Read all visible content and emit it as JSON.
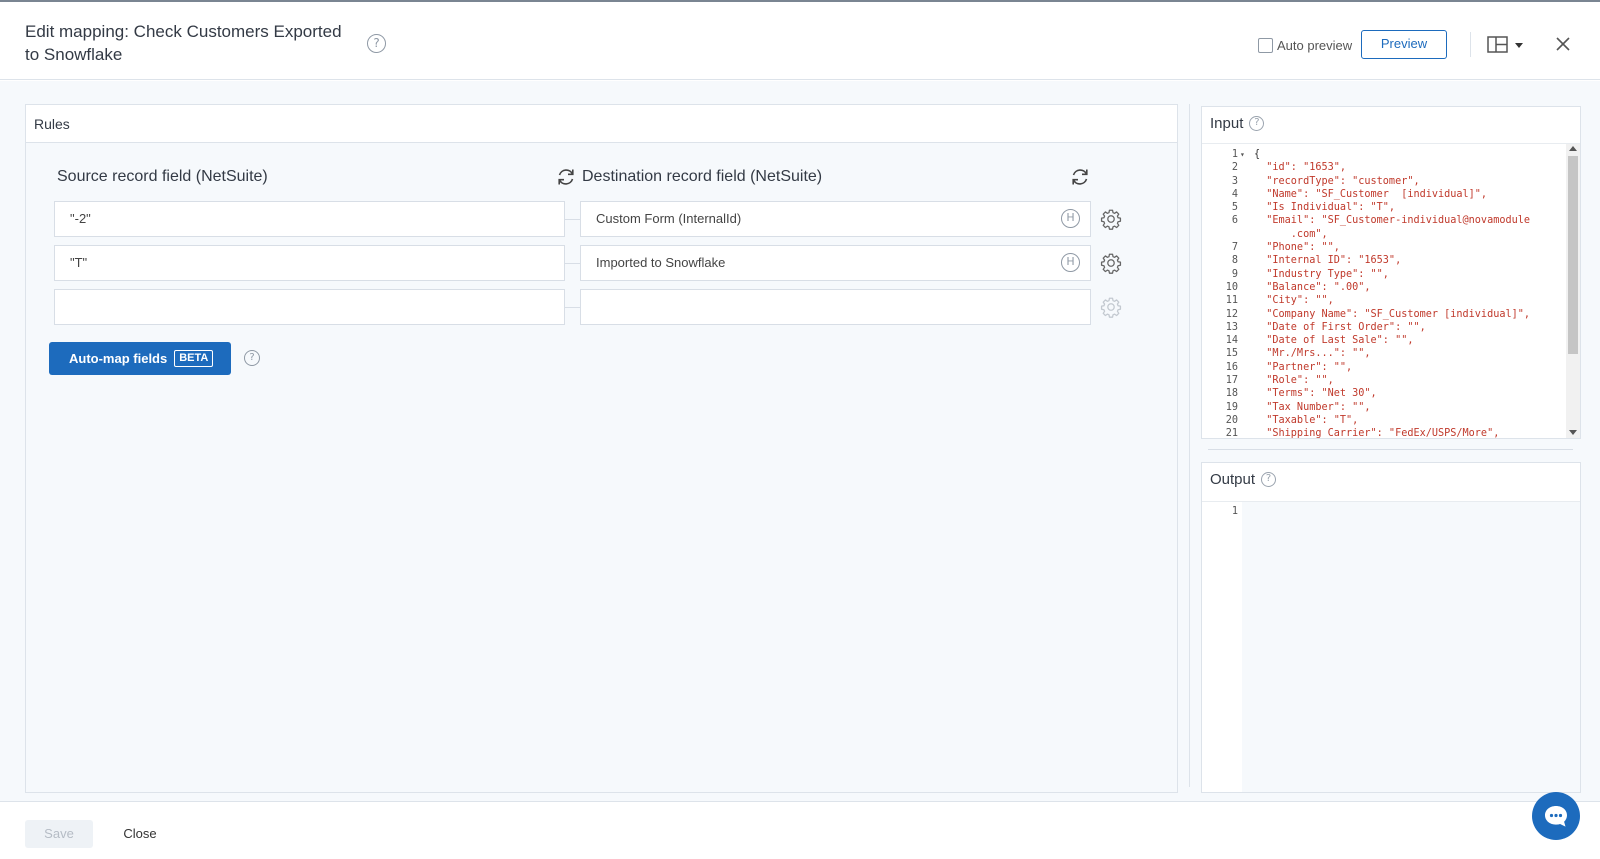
{
  "header": {
    "title": "Edit mapping: Check Customers Exported to Snowflake",
    "help_glyph": "?",
    "auto_preview_label": "Auto preview",
    "preview_label": "Preview"
  },
  "rules": {
    "title": "Rules",
    "source_header": "Source record field (NetSuite)",
    "destination_header": "Destination record field (NetSuite)",
    "rows": [
      {
        "source": "\"-2\"",
        "destination": "Custom Form (InternalId)",
        "badge": "H"
      },
      {
        "source": "\"T\"",
        "destination": "Imported to Snowflake",
        "badge": "H"
      },
      {
        "source": "",
        "destination": "",
        "badge": ""
      }
    ],
    "automap_label": "Auto-map fields",
    "beta_label": "BETA"
  },
  "input": {
    "title": "Input",
    "lines": [
      {
        "n": "1",
        "text": "{"
      },
      {
        "n": "2",
        "text": "  \"id\": \"1653\","
      },
      {
        "n": "3",
        "text": "  \"recordType\": \"customer\","
      },
      {
        "n": "4",
        "text": "  \"Name\": \"SF_Customer  [individual]\","
      },
      {
        "n": "5",
        "text": "  \"Is Individual\": \"T\","
      },
      {
        "n": "6",
        "text": "  \"Email\": \"SF_Customer-individual@novamodule"
      },
      {
        "n": "",
        "text": "      .com\","
      },
      {
        "n": "7",
        "text": "  \"Phone\": \"\","
      },
      {
        "n": "8",
        "text": "  \"Internal ID\": \"1653\","
      },
      {
        "n": "9",
        "text": "  \"Industry Type\": \"\","
      },
      {
        "n": "10",
        "text": "  \"Balance\": \".00\","
      },
      {
        "n": "11",
        "text": "  \"City\": \"\","
      },
      {
        "n": "12",
        "text": "  \"Company Name\": \"SF_Customer [individual]\","
      },
      {
        "n": "13",
        "text": "  \"Date of First Order\": \"\","
      },
      {
        "n": "14",
        "text": "  \"Date of Last Sale\": \"\","
      },
      {
        "n": "15",
        "text": "  \"Mr./Mrs...\": \"\","
      },
      {
        "n": "16",
        "text": "  \"Partner\": \"\","
      },
      {
        "n": "17",
        "text": "  \"Role\": \"\","
      },
      {
        "n": "18",
        "text": "  \"Terms\": \"Net 30\","
      },
      {
        "n": "19",
        "text": "  \"Tax Number\": \"\","
      },
      {
        "n": "20",
        "text": "  \"Taxable\": \"T\","
      },
      {
        "n": "21",
        "text": "  \"Shipping Carrier\": \"FedEx/USPS/More\","
      }
    ]
  },
  "output": {
    "title": "Output",
    "line_number": "1"
  },
  "footer": {
    "save_label": "Save",
    "close_label": "Close"
  },
  "colors": {
    "accent": "#1d6bbd",
    "json_string": "#c0392b"
  }
}
